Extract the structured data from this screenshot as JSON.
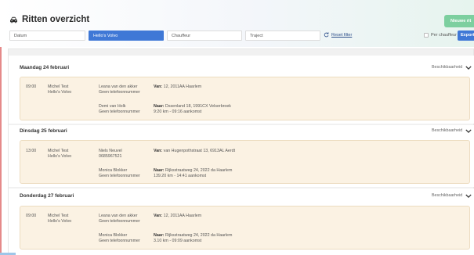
{
  "header": {
    "title": "Ritten overzicht",
    "new_button": "Nieuwe rit"
  },
  "filters": {
    "datum": "Datum",
    "vehicle": "Hello's Volvo",
    "driver": "Chauffeur",
    "route": "Traject",
    "reset": "Reset filter",
    "per_chauffeur": "Per chauffeur",
    "export": "Export"
  },
  "days": [
    {
      "title": "Maandag 24 februari",
      "availability": "Beschikbaarheid",
      "ride": {
        "time": "09:00",
        "driver": "Michel Test",
        "vehicle": "Hello's Volvo",
        "pickup": {
          "name": "Leana van den akker",
          "phone": "Geen telefoonnummer",
          "label": "Van:",
          "address": "12, 2011AA Haarlem"
        },
        "dropoff": {
          "name": "Demi van Holk",
          "phone": "Geen telefoonnummer",
          "label": "Naar:",
          "address": "Dssenland 18, 1991CX Velserbroek",
          "eta": "9:20 km - 09:16 aankomst"
        }
      }
    },
    {
      "title": "Dinsdag 25 februari",
      "availability": "Beschikbaarheid",
      "ride": {
        "time": "13:00",
        "driver": "Michel Test",
        "vehicle": "Hello's Volvo",
        "pickup": {
          "name": "Niels Neuvel",
          "phone": "0685967521",
          "label": "Van:",
          "address": "van Hugenpothstraat 13, 6913AL Aerdt"
        },
        "dropoff": {
          "name": "Monica Blokker",
          "phone": "Geen telefoonnummer",
          "label": "Naar:",
          "address": "Rijksstraatweg 24, 2022 da Haarlem",
          "eta": "139.20 km - 14:41 aankomst"
        }
      }
    },
    {
      "title": "Donderdag 27 februari",
      "availability": "Beschikbaarheid",
      "ride": {
        "time": "09:00",
        "driver": "Michel Test",
        "vehicle": "Hello's Volvo",
        "pickup": {
          "name": "Leana van den akker",
          "phone": "Geen telefoonnummer",
          "label": "Van:",
          "address": "12, 2011AA Haarlem"
        },
        "dropoff": {
          "name": "Monica Blokker",
          "phone": "Geen telefoonnummer",
          "label": "Naar:",
          "address": "Rijksstraatweg 24, 2022 da Haarlem",
          "eta": "3.10 km - 09:09 aankomst"
        }
      }
    }
  ]
}
